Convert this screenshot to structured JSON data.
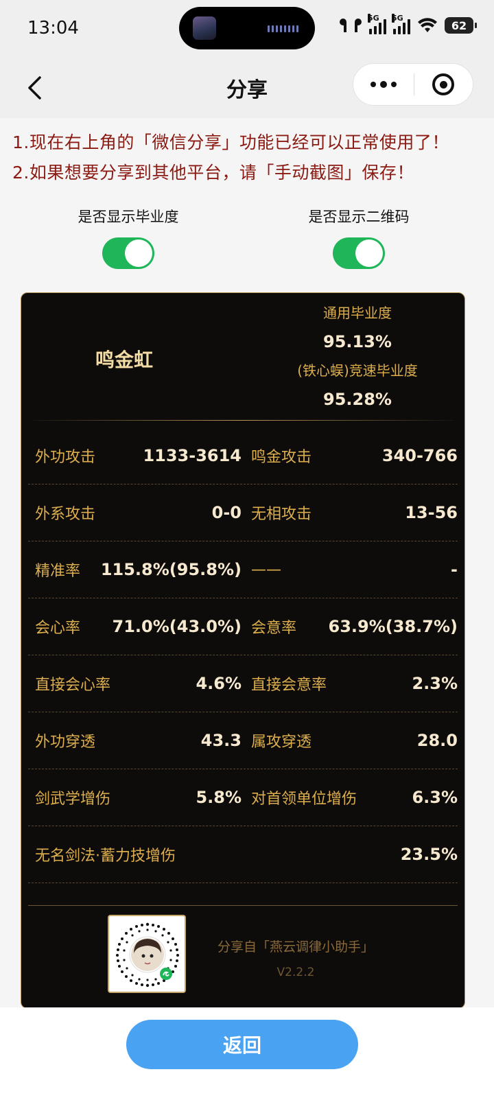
{
  "status_bar": {
    "time": "13:04",
    "net1": "5G",
    "net2": "5G",
    "battery": "62"
  },
  "nav": {
    "title": "分享"
  },
  "notices": [
    "1.现在右上角的「微信分享」功能已经可以正常使用了！",
    "2.如果想要分享到其他平台，请「手动截图」保存！"
  ],
  "toggles": [
    {
      "label": "是否显示毕业度",
      "on": true
    },
    {
      "label": "是否显示二维码",
      "on": true
    }
  ],
  "card": {
    "character_name": "鸣金虹",
    "general_label": "通用毕业度",
    "general_value": "95.13%",
    "speed_label": "(铁心蜈)竞速毕业度",
    "speed_value": "95.28%",
    "stats": [
      {
        "l1": "外功攻击",
        "v1": "1133-3614",
        "l2": "鸣金攻击",
        "v2": "340-766"
      },
      {
        "l1": "外系攻击",
        "v1": "0-0",
        "l2": "无相攻击",
        "v2": "13-56"
      },
      {
        "l1": "精准率",
        "v1": "115.8%(95.8%)",
        "l2": "——",
        "v2": "-"
      },
      {
        "l1": "会心率",
        "v1": "71.0%(43.0%)",
        "l2": "会意率",
        "v2": "63.9%(38.7%)"
      },
      {
        "l1": "直接会心率",
        "v1": "4.6%",
        "l2": "直接会意率",
        "v2": "2.3%"
      },
      {
        "l1": "外功穿透",
        "v1": "43.3",
        "l2": "属攻穿透",
        "v2": "28.0"
      },
      {
        "l1": "剑武学增伤",
        "v1": "5.8%",
        "l2": "对首领单位增伤",
        "v2": "6.3%"
      }
    ],
    "wide_stat": {
      "label": "无名剑法·蓄力技增伤",
      "value": "23.5%"
    },
    "share_from": "分享自「燕云调律小助手」",
    "version": "V2.2.2"
  },
  "return_button": "返回"
}
